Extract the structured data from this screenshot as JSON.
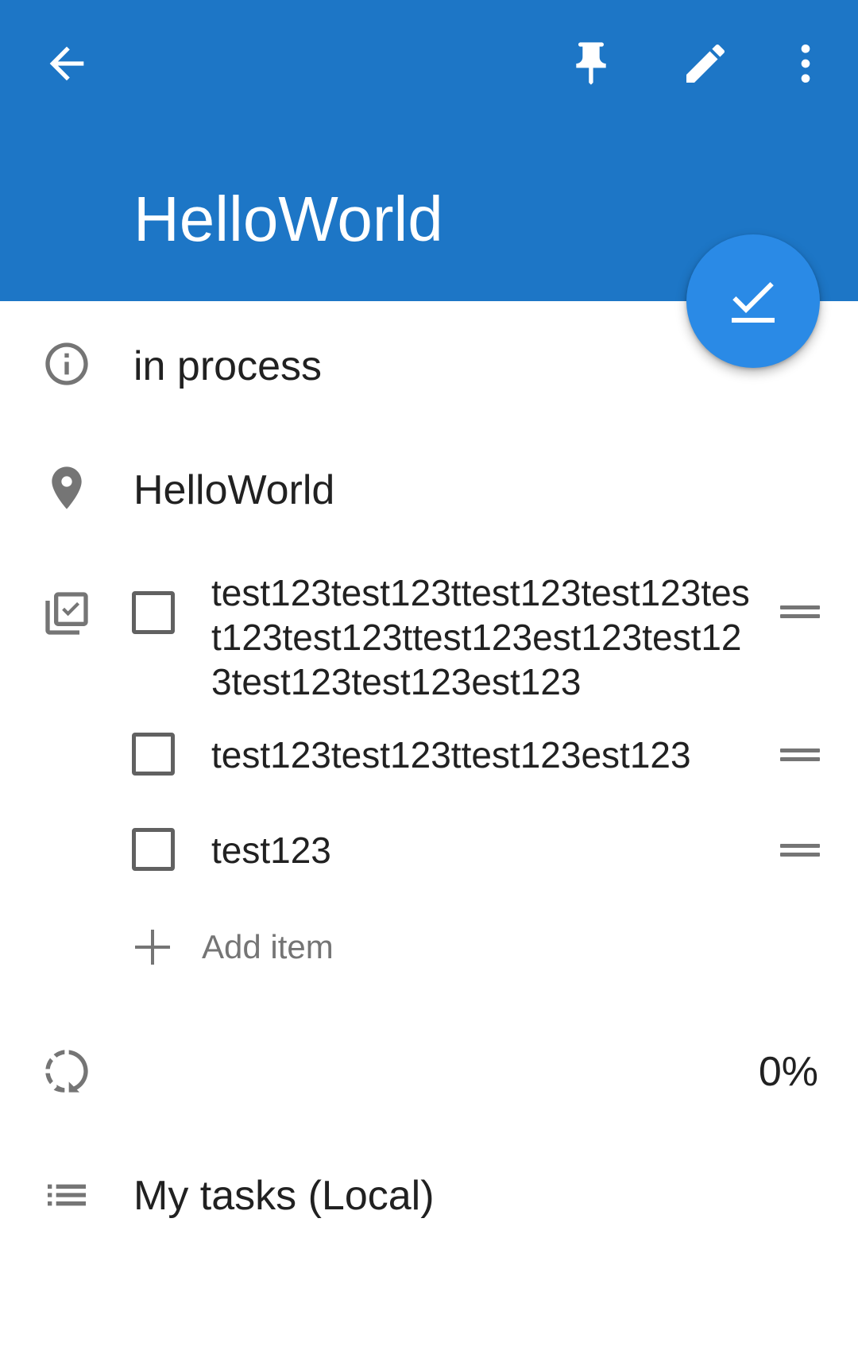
{
  "appbar": {
    "title": "HelloWorld",
    "background_color": "#1d76c6",
    "icons": {
      "back": "arrow-back-icon",
      "pin": "pin-icon",
      "edit": "edit-pencil-icon",
      "more": "more-vert-icon"
    }
  },
  "fab": {
    "icon": "check-done-icon",
    "color": "#2a8ae6"
  },
  "task": {
    "status": "in process",
    "location": "HelloWorld",
    "checklist": {
      "items": [
        {
          "text": "test123test123ttest123test123test123test123ttest123est123test123test123test123est123",
          "checked": false
        },
        {
          "text": "test123test123ttest123est123",
          "checked": false
        },
        {
          "text": "test123",
          "checked": false
        }
      ],
      "add_item_label": "Add item"
    },
    "progress": "0%",
    "list_name": "My tasks (Local)"
  }
}
